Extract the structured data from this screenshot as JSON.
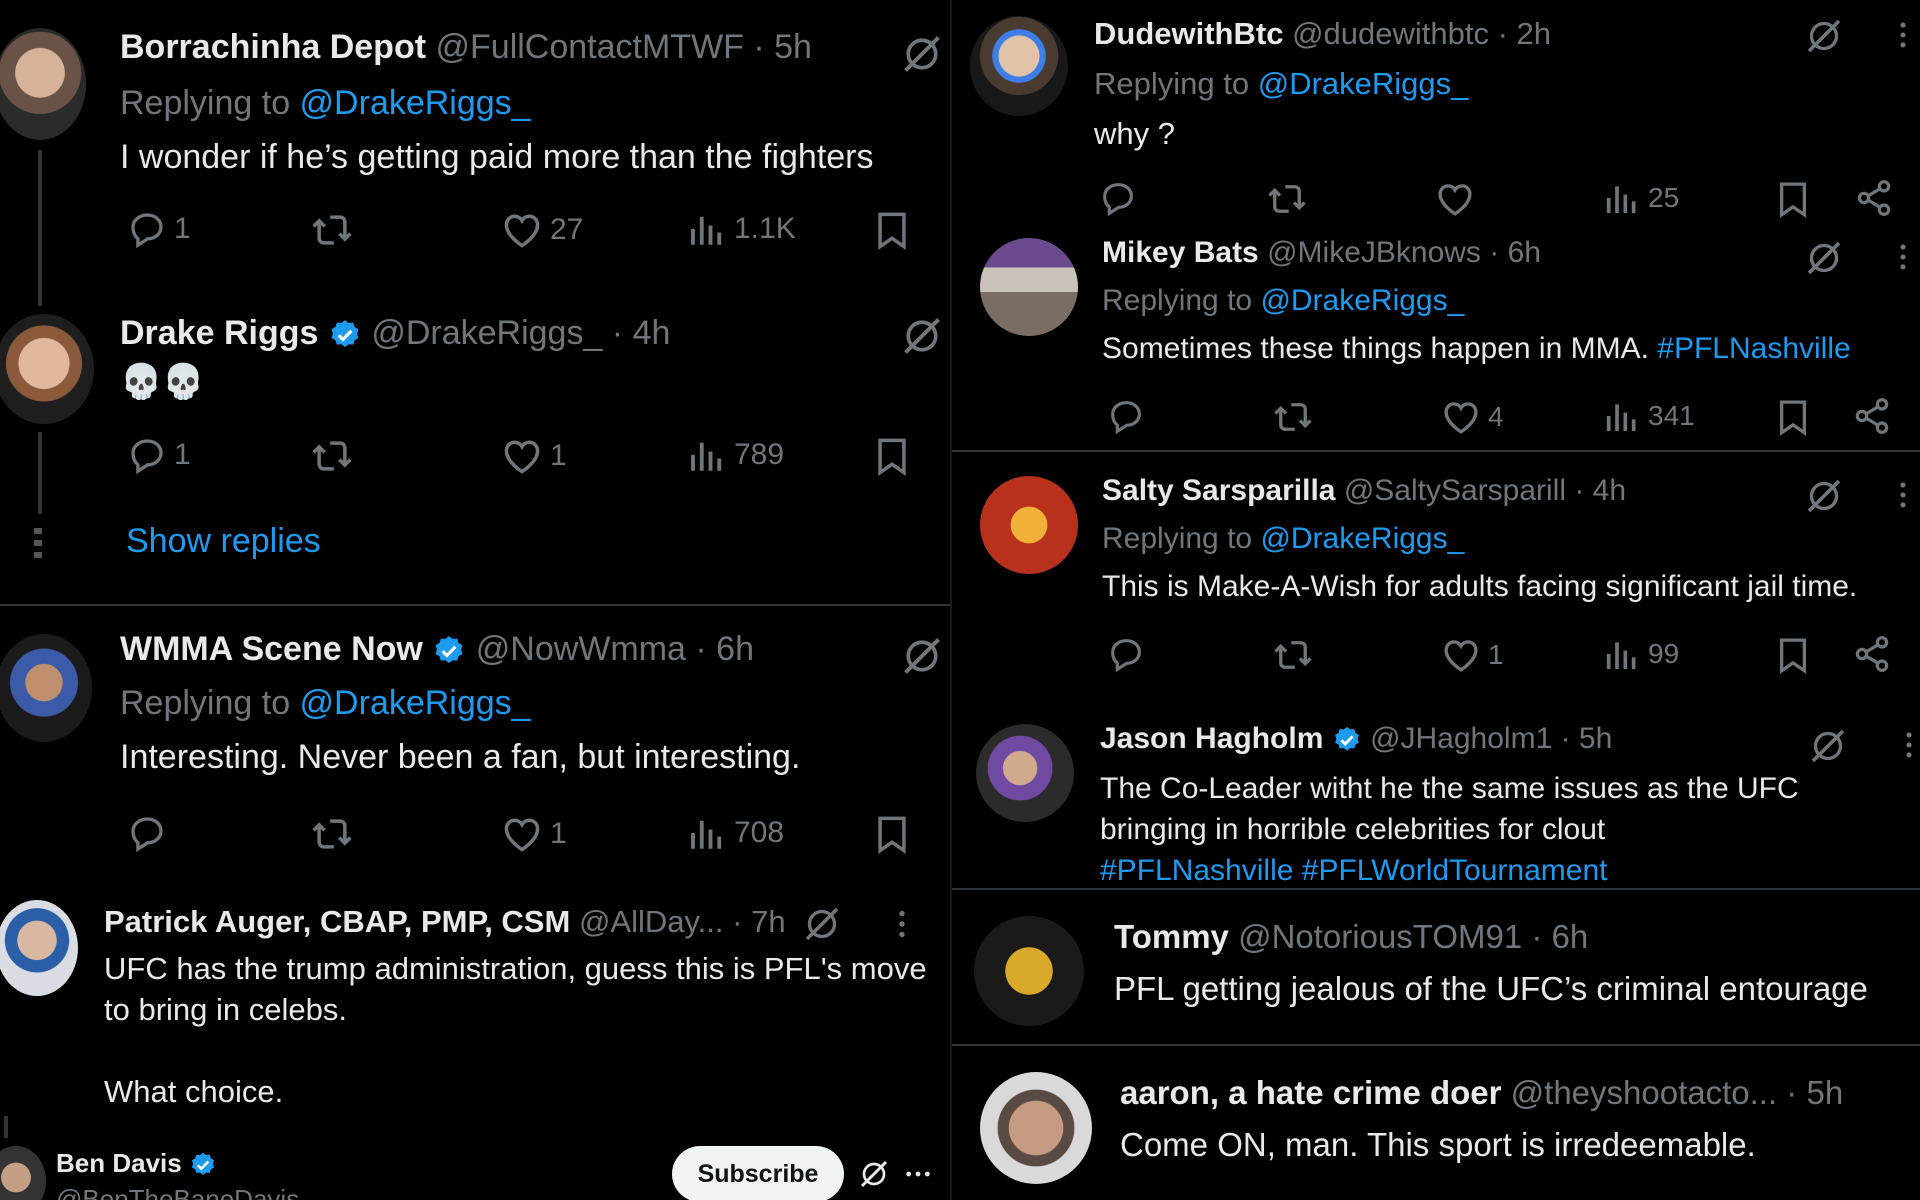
{
  "colors": {
    "bg": "#000000",
    "text": "#e7e9ea",
    "muted": "#71767b",
    "accent": "#1d9bf0",
    "divider": "#2f3336"
  },
  "left": {
    "tweets": [
      {
        "name": "Borrachinha Depot",
        "handle": "@FullContactMTWF · 5h",
        "replying_prefix": "Replying to ",
        "replying_to": "@DrakeRiggs_",
        "text": "I wonder if he’s getting paid more than the fighters",
        "replies": "1",
        "likes": "27",
        "views": "1.1K"
      },
      {
        "name": "Drake Riggs",
        "handle": "@DrakeRiggs_ · 4h",
        "text": "💀💀",
        "replies": "1",
        "likes": "1",
        "views": "789",
        "show_replies": "Show replies"
      },
      {
        "name": "WMMA Scene Now",
        "handle": "@NowWmma · 6h",
        "replying_prefix": "Replying to ",
        "replying_to": "@DrakeRiggs_",
        "text": "Interesting. Never been a fan, but interesting.",
        "likes": "1",
        "views": "708"
      },
      {
        "name": "Patrick Auger, CBAP, PMP, CSM",
        "handle": "@AllDay... · 7h",
        "text_line1": "UFC has the trump administration, guess this is PFL's move",
        "text_line2": "to bring in celebs.",
        "text_line3": "What choice."
      },
      {
        "name": "Ben Davis",
        "handle": "@BenTheBaneDavis",
        "subscribe": "Subscribe"
      }
    ]
  },
  "right": {
    "tweets": [
      {
        "name": "DudewithBtc",
        "handle": "@dudewithbtc · 2h",
        "replying_prefix": "Replying to ",
        "replying_to": "@DrakeRiggs_",
        "text": "why ?",
        "views": "25"
      },
      {
        "name": "Mikey Bats",
        "handle": "@MikeJBknows · 6h",
        "replying_prefix": "Replying to ",
        "replying_to": "@DrakeRiggs_",
        "text": "Sometimes these things happen in MMA. ",
        "hashtag": "#PFLNashville",
        "likes": "4",
        "views": "341"
      },
      {
        "name": "Salty Sarsparilla",
        "handle": "@SaltySarsparill · 4h",
        "replying_prefix": "Replying to ",
        "replying_to": "@DrakeRiggs_",
        "text": "This is Make-A-Wish for adults facing significant jail time.",
        "likes": "1",
        "views": "99"
      },
      {
        "name": "Jason Hagholm",
        "handle": "@JHagholm1 · 5h",
        "text_line1": "The Co-Leader witht he the same issues as the UFC",
        "text_line2": "bringing in horrible celebrities for clout",
        "hashtag1": "#PFLNashville",
        "hashtag2": "#PFLWorldTournament"
      },
      {
        "name": "Tommy",
        "handle": "@NotoriousTOM91 · 6h",
        "text": "PFL getting jealous of the UFC’s criminal entourage"
      },
      {
        "name": "aaron, a hate crime doer",
        "handle": "@theyshootacto... · 5h",
        "text": "Come ON, man. This sport is irredeemable."
      }
    ]
  },
  "icons": [
    "reply-icon",
    "retweet-icon",
    "like-icon",
    "views-icon",
    "bookmark-icon",
    "share-icon",
    "grok-icon",
    "more-icon",
    "verified-icon"
  ]
}
